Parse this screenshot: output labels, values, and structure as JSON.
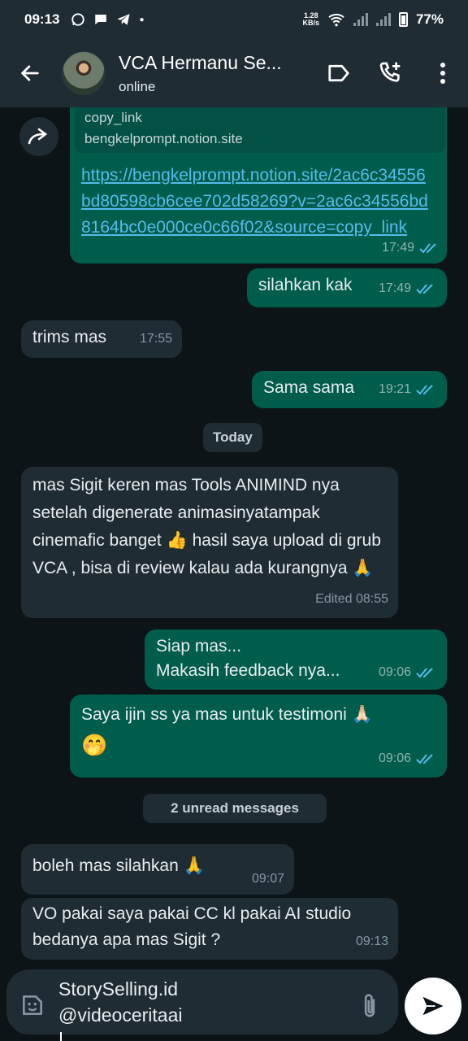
{
  "status_bar": {
    "time": "09:13",
    "net_speed_value": "1.28",
    "net_speed_unit": "KB/s",
    "battery": "77%"
  },
  "header": {
    "contact_name": "VCA Hermanu Se...",
    "contact_status": "online"
  },
  "messages": [
    {
      "quote_line1": "copy_link",
      "quote_line2": "bengkelprompt.notion.site",
      "link_text": "https://bengkelprompt.notion.site/2ac6c34556bd80598cb6cee702d58269?v=2ac6c34556bd8164bc0e000ce0c66f02&source=copy_link",
      "time": "17:49"
    },
    {
      "text": "silahkan kak",
      "time": "17:49"
    },
    {
      "text": "trims mas",
      "time": "17:55"
    },
    {
      "text": "Sama sama",
      "time": "19:21"
    },
    {
      "text": "mas Sigit keren mas Tools ANIMIND nya setelah digenerate animasinyatampak cinemafic banget 👍 hasil saya upload di grub VCA , bisa di review kalau ada kurangnya 🙏",
      "time": "Edited 08:55"
    },
    {
      "line1": "Siap mas...",
      "line2": "Makasih feedback nya...",
      "time": "09:06"
    },
    {
      "text": "Saya ijin ss ya mas untuk testimoni 🙏🏻",
      "emoji": "🤭",
      "time": "09:06"
    },
    {
      "text": "boleh mas silahkan 🙏",
      "time": "09:07"
    },
    {
      "text": "VO pakai saya pakai CC kl pakai AI studio bedanya apa mas Sigit ?",
      "time": "09:13"
    }
  ],
  "separators": {
    "today": "Today",
    "unread": "2 unread messages"
  },
  "composer": {
    "line1": "StorySelling.id",
    "line2": "@videoceritaai"
  },
  "colors": {
    "outgoing_bubble": "#005c4b",
    "incoming_bubble": "#1f2c34",
    "link": "#53bdeb",
    "read_ticks": "#53bdeb"
  }
}
